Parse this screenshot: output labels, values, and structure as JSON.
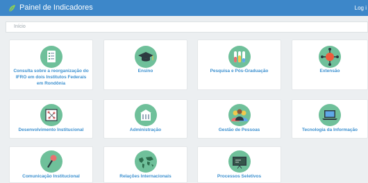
{
  "header": {
    "title": "Painel de Indicadores",
    "login": "Log i"
  },
  "breadcrumb": {
    "label": "Início"
  },
  "cards": [
    {
      "label": "Consulta sobre a reorganização do IFRO em dois Institutos Federais em Rondônia",
      "icon": "document-checklist-icon"
    },
    {
      "label": "Ensino",
      "icon": "graduation-cap-icon"
    },
    {
      "label": "Pesquisa e Pós-Graduação",
      "icon": "test-tubes-icon"
    },
    {
      "label": "Extensão",
      "icon": "network-icon"
    },
    {
      "label": "Desenvolvimento Institucional",
      "icon": "chart-diagram-icon"
    },
    {
      "label": "Administração",
      "icon": "building-icon"
    },
    {
      "label": "Gestão de Pessoas",
      "icon": "people-icon"
    },
    {
      "label": "Tecnologia da Informação",
      "icon": "laptop-icon"
    },
    {
      "label": "Comunicação Institucional",
      "icon": "microphone-icon"
    },
    {
      "label": "Relações Internacionais",
      "icon": "world-map-icon"
    },
    {
      "label": "Processos Seletivos",
      "icon": "chalkboard-icon"
    }
  ],
  "colors": {
    "header": "#3d87c9",
    "accent": "#3a8fcf",
    "icon_bg": "#6fc09a"
  }
}
